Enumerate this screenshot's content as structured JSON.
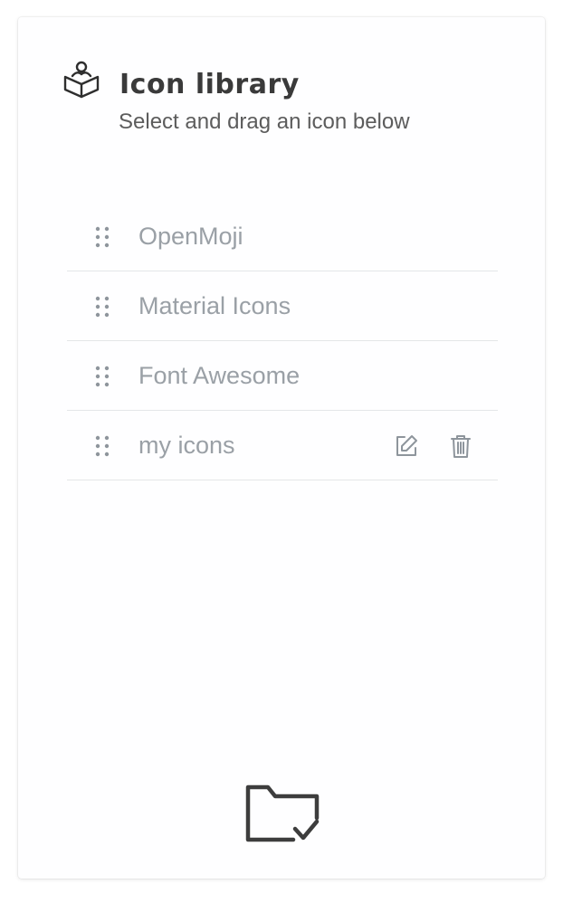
{
  "header": {
    "icon": "reading-person-icon",
    "title": "Icon library",
    "subtitle": "Select and drag an icon below"
  },
  "libraries": [
    {
      "label": "OpenMoji",
      "editable": false
    },
    {
      "label": "Material Icons",
      "editable": false
    },
    {
      "label": "Font Awesome",
      "editable": false
    },
    {
      "label": "my icons",
      "editable": true
    }
  ],
  "item_icons": {
    "handle": "drag-handle-icon",
    "edit": "edit-icon",
    "delete": "trash-icon"
  },
  "footer": {
    "icon": "folder-check-icon"
  },
  "colors": {
    "title": "#3a3a3a",
    "subtitle": "#5c5c5c",
    "item_text": "#9aa0a6",
    "divider": "#e4e6e8",
    "footer_icon": "#3d3d3d"
  }
}
